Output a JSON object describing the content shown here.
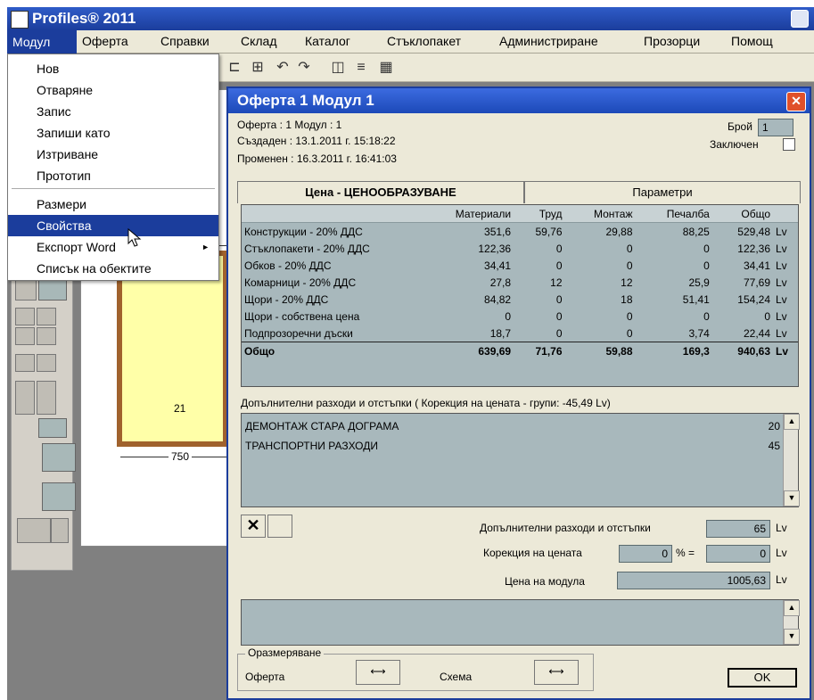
{
  "app": {
    "title": "Profiles® 2011"
  },
  "menubar": [
    "Модул",
    "Оферта",
    "Справки",
    "Склад",
    "Каталог",
    "Стъклопакет",
    "Администриране",
    "Прозорци",
    "Помощ"
  ],
  "dropdown": {
    "items": [
      "Нов",
      "Отваряне",
      "Запис",
      "Запиши като",
      "Изтриване",
      "Прототип"
    ],
    "items2": [
      "Размери",
      "Свойства",
      "Експорт Word",
      "Списък на обектите"
    ],
    "selected": "Свойства",
    "submenu_arrow": "►"
  },
  "drawing": {
    "label_21": "21",
    "dim_750": "750"
  },
  "dialog": {
    "title": "Оферта 1     Модул 1",
    "info_line1": "Оферта : 1       Модул : 1",
    "info_created": "Създаден : 13.1.2011 г. 15:18:22",
    "info_modified": "Променен : 16.3.2011 г. 16:41:03",
    "count_label": "Брой",
    "count_value": "1",
    "locked_label": "Заключен",
    "tabs": [
      "Цена - ЦЕНООБРАЗУВАНЕ",
      "Параметри"
    ],
    "table": {
      "headers": [
        "",
        "Материали",
        "Труд",
        "Монтаж",
        "Печалба",
        "Общо",
        ""
      ],
      "rows": [
        [
          "Конструкции - 20% ДДС",
          "351,6",
          "59,76",
          "29,88",
          "88,25",
          "529,48",
          "Lv"
        ],
        [
          "Стъклопакети - 20% ДДС",
          "122,36",
          "0",
          "0",
          "0",
          "122,36",
          "Lv"
        ],
        [
          "Обков - 20% ДДС",
          "34,41",
          "0",
          "0",
          "0",
          "34,41",
          "Lv"
        ],
        [
          "Комарници - 20% ДДС",
          "27,8",
          "12",
          "12",
          "25,9",
          "77,69",
          "Lv"
        ],
        [
          "Щори - 20% ДДС",
          "84,82",
          "0",
          "18",
          "51,41",
          "154,24",
          "Lv"
        ],
        [
          "Щори - собствена цена",
          "0",
          "0",
          "0",
          "0",
          "0",
          "Lv"
        ],
        [
          "Подпрозоречни дъски",
          "18,7",
          "0",
          "0",
          "3,74",
          "22,44",
          "Lv"
        ]
      ],
      "total": [
        "Общо",
        "639,69",
        "71,76",
        "59,88",
        "169,3",
        "940,63",
        "Lv"
      ]
    },
    "extra_header": "Допълнителни разходи и отстъпки  ( Корекция на цената - групи: -45,49 Lv)",
    "extra_items": [
      {
        "name": "ДЕМОНТАЖ СТАРА ДОГРАМА",
        "value": "20"
      },
      {
        "name": "ТРАНСПОРТНИ РАЗХОДИ",
        "value": "45"
      }
    ],
    "extra_total_label": "Допълнителни разходи и отстъпки",
    "extra_total_value": "65",
    "correction_label": "Корекция на цената",
    "correction_pct": "0",
    "correction_eq": "% =",
    "correction_value": "0",
    "module_price_label": "Цена на модула",
    "module_price_value": "1005,63",
    "currency": "Lv",
    "dim_group": "Оразмеряване",
    "dim_offer": "Оферта",
    "dim_scheme": "Схема",
    "ok": "OK"
  }
}
